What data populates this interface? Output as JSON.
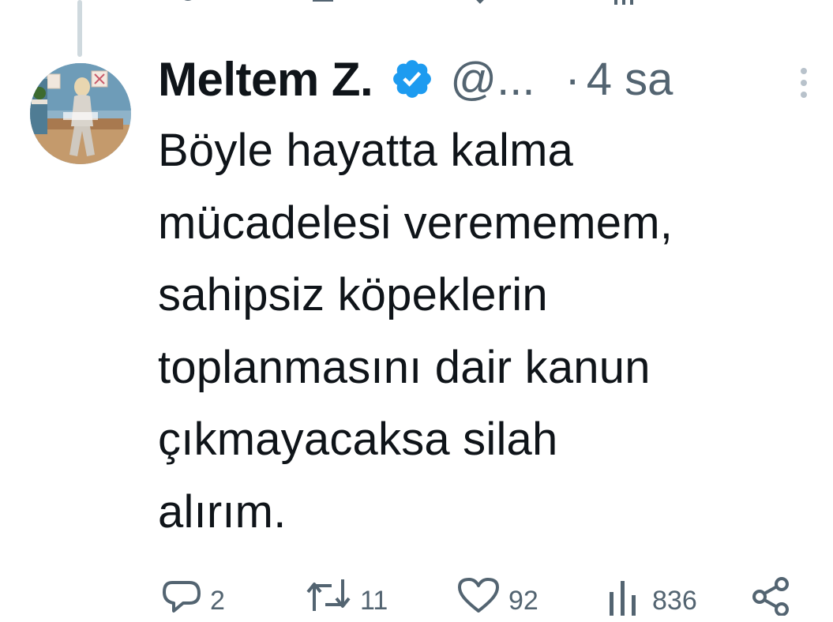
{
  "tweet": {
    "author": {
      "display_name": "Meltem Z.",
      "handle": "@...",
      "verified": true
    },
    "time_separator": "·",
    "time": "4 sa",
    "text": "Böyle hayatta kalma\nmücadelesi verememem,\nsahipsiz köpeklerin\ntoplanmasını dair kanun\nçıkmayacaksa silah\nalırım.",
    "stats": {
      "replies": "2",
      "retweets": "11",
      "likes": "92",
      "views": "836"
    }
  },
  "colors": {
    "text": "#0f1419",
    "secondary": "#536471",
    "verified_blue": "#1d9bf0",
    "thread_line": "#cfd9de"
  },
  "icons": {
    "verified": "verified-badge-icon",
    "more": "more-vertical-icon",
    "reply": "reply-bubble-icon",
    "retweet": "retweet-icon",
    "like": "heart-icon",
    "views": "views-bar-chart-icon",
    "share": "share-icon"
  }
}
